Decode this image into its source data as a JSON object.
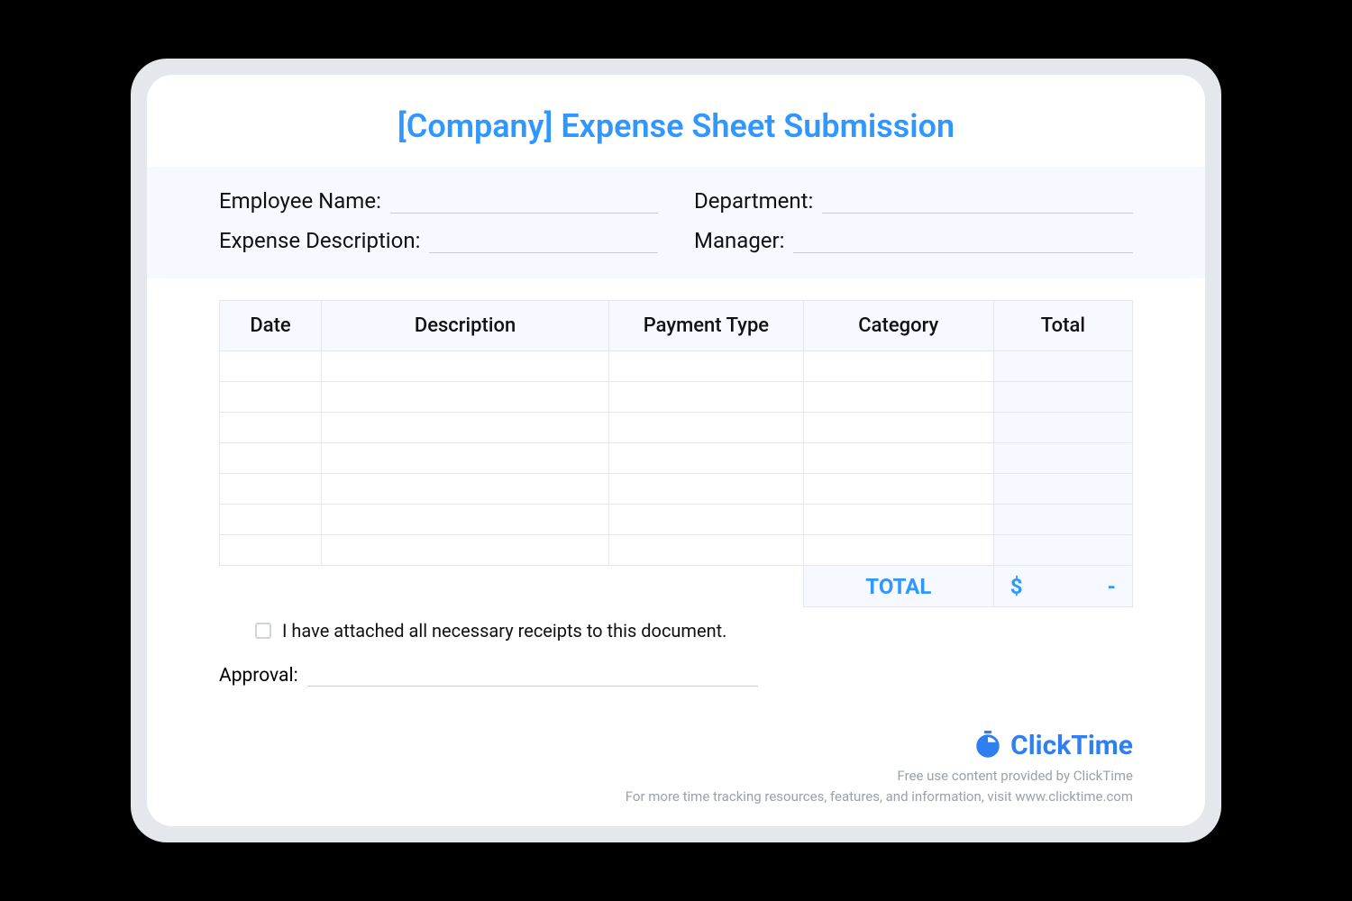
{
  "title": "[Company] Expense Sheet Submission",
  "fields": {
    "employee_name": "Employee Name:",
    "department": "Department:",
    "expense_desc": "Expense Description:",
    "manager": "Manager:"
  },
  "table": {
    "headers": {
      "date": "Date",
      "description": "Description",
      "payment_type": "Payment Type",
      "category": "Category",
      "total": "Total"
    },
    "row_count": 7,
    "footer_label": "TOTAL",
    "footer_currency": "$",
    "footer_value": "-"
  },
  "receipt_text": "I have attached all necessary receipts to this document.",
  "approval_label": "Approval:",
  "brand_name": "ClickTime",
  "credit_line1": "Free use content provided by ClickTime",
  "credit_line2": "For more time tracking resources, features, and information, visit www.clicktime.com"
}
